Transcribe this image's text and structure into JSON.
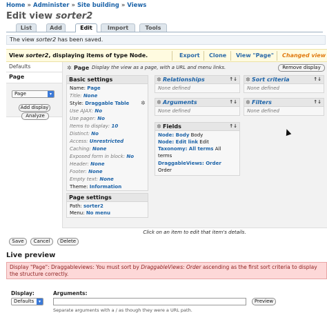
{
  "breadcrumb": [
    "Home",
    "Administer",
    "Site building",
    "Views"
  ],
  "breadcrumb_sep": "»",
  "title": {
    "prefix": "Edit view ",
    "name": "sorter2"
  },
  "tabs": [
    {
      "label": "List",
      "active": false
    },
    {
      "label": "Add",
      "active": false
    },
    {
      "label": "Edit",
      "active": true
    },
    {
      "label": "Import",
      "active": false
    },
    {
      "label": "Tools",
      "active": false
    }
  ],
  "status": {
    "before": "The view ",
    "name": "sorter2",
    "after": " has been saved."
  },
  "viewbar": {
    "before": "View ",
    "name": "sorter2",
    "after": ", displaying items of type Node.",
    "links": [
      "Export",
      "Clone",
      "View \"Page\""
    ],
    "changed": "Changed view"
  },
  "displays": {
    "defaults": "Defaults",
    "page": "Page"
  },
  "add_display": {
    "select_value": "Page",
    "add_button": "Add display",
    "analyze_button": "Analyze"
  },
  "main": {
    "display_title": "Page",
    "display_desc": "Display the view as a page, with a URL and menu links.",
    "remove_button": "Remove display",
    "basic": {
      "title": "Basic settings",
      "rows": [
        {
          "label": "Name:",
          "value": "Page",
          "dim": false
        },
        {
          "label": "Title:",
          "value": "None",
          "dim": true
        },
        {
          "label": "Style:",
          "value": "Draggable Table",
          "dim": false
        },
        {
          "label": "Use AJAX:",
          "value": "No",
          "dim": true
        },
        {
          "label": "Use pager:",
          "value": "No",
          "dim": true
        },
        {
          "label": "Items to display:",
          "value": "10",
          "dim": true
        },
        {
          "label": "Distinct:",
          "value": "No",
          "dim": true
        },
        {
          "label": "Access:",
          "value": "Unrestricted",
          "dim": true
        },
        {
          "label": "Caching:",
          "value": "None",
          "dim": true
        },
        {
          "label": "Exposed form in block:",
          "value": "No",
          "dim": true
        },
        {
          "label": "Header:",
          "value": "None",
          "dim": true
        },
        {
          "label": "Footer:",
          "value": "None",
          "dim": true
        },
        {
          "label": "Empty text:",
          "value": "None",
          "dim": true
        },
        {
          "label": "Theme:",
          "value": "Information",
          "dim": false
        }
      ]
    },
    "page_settings": {
      "title": "Page settings",
      "rows": [
        {
          "label": "Path:",
          "value": "sorter2"
        },
        {
          "label": "Menu:",
          "value": "No menu"
        }
      ]
    },
    "relationships": {
      "title": "Relationships",
      "empty": "None defined",
      "arrange": "↑↓"
    },
    "arguments": {
      "title": "Arguments",
      "empty": "None defined",
      "arrange": "↑↓"
    },
    "fields": {
      "title": "Fields",
      "arrange": "↑↓",
      "lines": [
        {
          "link": "Node: Body",
          "text": " Body"
        },
        {
          "link": "Node: Edit link",
          "text": " Edit"
        },
        {
          "link": "Taxonomy: All terms",
          "text": " All"
        },
        {
          "link": "",
          "text": "terms"
        },
        {
          "link": "DraggableViews: Order",
          "text": ""
        },
        {
          "link": "",
          "text": "Order"
        }
      ]
    },
    "sort": {
      "title": "Sort criteria",
      "empty": "None defined",
      "arrange": "↑↓"
    },
    "filters": {
      "title": "Filters",
      "empty": "None defined",
      "arrange": "↑↓"
    },
    "hint": "Click on an item to edit that item's details."
  },
  "actions": {
    "save": "Save",
    "cancel": "Cancel",
    "delete": "Delete"
  },
  "preview": {
    "title": "Live preview",
    "error_before": "Display \"Page\": Draggableviews: You must sort by ",
    "error_em": "DraggableViews: Order",
    "error_after": " ascending as the first sort criteria to display the structure correctly.",
    "display_label": "Display:",
    "display_value": "Defaults",
    "arguments_label": "Arguments:",
    "arguments_value": "",
    "preview_button": "Preview",
    "arguments_desc": "Separate arguments with a / as though they were a URL path."
  },
  "colors": {
    "link": "#1c63a8",
    "changed": "#e07a10",
    "error_bg": "#fdd8d8",
    "select_arrow": "#3b7ad9"
  },
  "icons": [
    "gear-icon",
    "arrange-icon",
    "select-arrow-icon",
    "mouse-cursor-icon"
  ]
}
